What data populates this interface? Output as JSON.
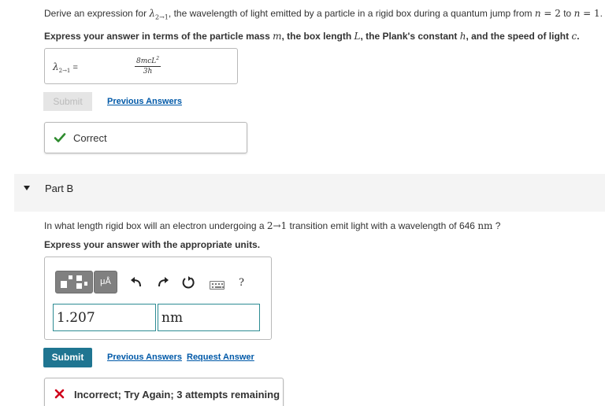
{
  "partA": {
    "prompt_pre": "Derive an expression for ",
    "prompt_lambda": "λ",
    "prompt_sub": "2→1",
    "prompt_mid": ", the wavelength of light emitted by a particle in a rigid box during a quantum jump from ",
    "prompt_n1": "n",
    "prompt_eq1": " = 2",
    "prompt_to": " to ",
    "prompt_n2": "n",
    "prompt_eq2": " = 1",
    "prompt_end": ".",
    "instruction_pre": "Express your answer in terms of the particle mass ",
    "var_m": "m",
    "instruction_mid1": ", the box length ",
    "var_L": "L",
    "instruction_mid2": ", the Plank's constant ",
    "var_h": "h",
    "instruction_mid3": ", and the speed of light ",
    "var_c": "c",
    "instruction_end": ".",
    "answer_lhs_lambda": "λ",
    "answer_lhs_sub": "2→1",
    "answer_lhs_eq": " = ",
    "answer_num": "8mcL",
    "answer_num_exp": "2",
    "answer_den": "3h",
    "submit_label": "Submit",
    "previous_answers_label": "Previous Answers",
    "feedback": "Correct"
  },
  "partB": {
    "title": "Part B",
    "prompt_pre": "In what length rigid box will an electron undergoing a ",
    "prompt_transition": "2→1",
    "prompt_mid": " transition emit light with a wavelength of 646 ",
    "prompt_unit": "nm",
    "prompt_end": " ?",
    "instruction": "Express your answer with the appropriate units.",
    "units_button_label": "μÅ",
    "help_label": "?",
    "value": "1.207",
    "unit": "nm",
    "submit_label": "Submit",
    "previous_answers_label": "Previous Answers",
    "request_answer_label": "Request Answer",
    "feedback": "Incorrect; Try Again; 3 attempts remaining"
  },
  "colors": {
    "submit_active": "#1f7591",
    "link": "#0059a8",
    "correct_check": "#2e8b2e",
    "incorrect_x": "#d0021b",
    "input_border": "#2d8c93"
  }
}
